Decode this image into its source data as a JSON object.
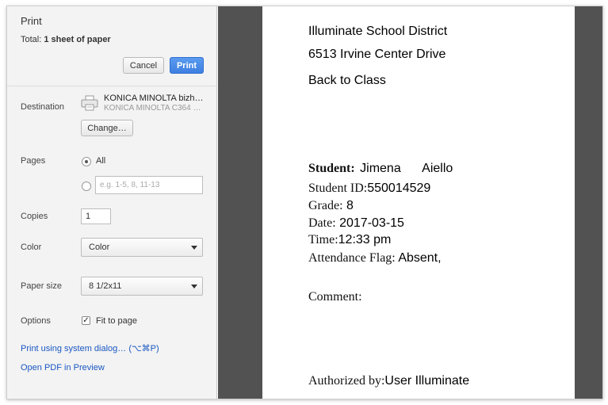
{
  "dialog": {
    "title": "Print",
    "total_prefix": "Total: ",
    "total_value": "1 sheet of paper",
    "cancel_label": "Cancel",
    "print_label": "Print"
  },
  "destination": {
    "label": "Destination",
    "printer_name": "KONICA MINOLTA bizh…",
    "printer_model": "KONICA MINOLTA C364 …",
    "change_label": "Change…",
    "icon": "printer-icon"
  },
  "pages": {
    "label": "Pages",
    "all_label": "All",
    "custom_placeholder": "e.g. 1-5, 8, 11-13",
    "selected": "all"
  },
  "copies": {
    "label": "Copies",
    "value": "1"
  },
  "color": {
    "label": "Color",
    "selected": "Color"
  },
  "paper_size": {
    "label": "Paper size",
    "selected": "8 1/2x11"
  },
  "options": {
    "label": "Options",
    "fit_to_page_label": "Fit to page",
    "fit_to_page_checked": true
  },
  "links": {
    "system_dialog": "Print using system dialog… (⌥⌘P)",
    "open_pdf": "Open PDF in Preview"
  },
  "document": {
    "district": "Illuminate School District",
    "address": "6513 Irvine Center Drive",
    "back_to_class": "Back to Class",
    "student_label": "Student:",
    "student_first": "Jimena",
    "student_last": "Aiello",
    "student_id_label": "Student ID:",
    "student_id": "550014529",
    "grade_label": "Grade:",
    "grade": "8",
    "date_label": "Date:",
    "date": "2017-03-15",
    "time_label": "Time:",
    "time": "12:33 pm",
    "flag_label": "Attendance Flag:",
    "flag": "Absent,",
    "comment_label": "Comment:",
    "authorized_label": "Authorized by:",
    "authorized_by": "User Illuminate"
  },
  "colors": {
    "panel_bg": "#f3f3f3",
    "preview_bg": "#525252",
    "accent_blue": "#3d7fe0",
    "link_blue": "#1a57c2"
  }
}
